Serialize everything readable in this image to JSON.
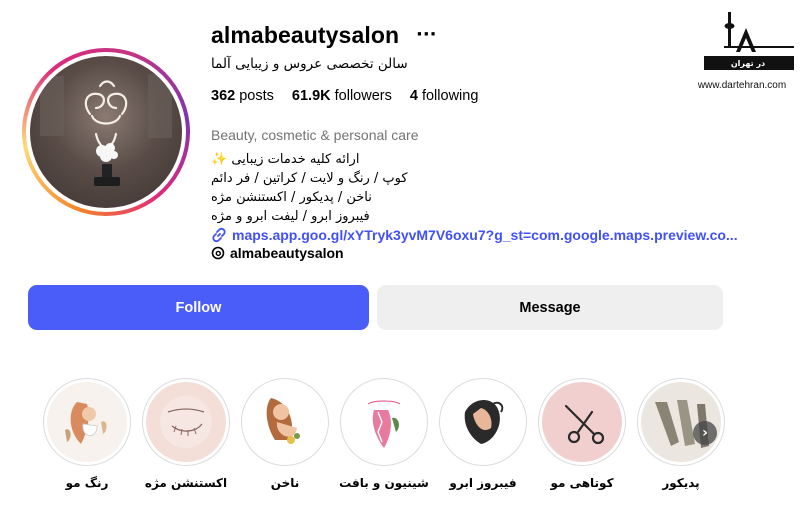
{
  "profile": {
    "username": "almabeautysalon",
    "more_icon": "more-horizontal-icon",
    "display_name": "سالن تخصصی عروس و زیبایی آلما",
    "stats": {
      "posts_count": "362",
      "posts_label": "posts",
      "followers_count": "61.9K",
      "followers_label": "followers",
      "following_count": "4",
      "following_label": "following"
    },
    "category": "Beauty, cosmetic & personal care",
    "bio_lines": [
      "ارائه کلیه خدمات زیبایی ✨",
      "کوپ / رنگ و لایت / کراتین / فر دائم",
      "ناخن / پدیکور / اکستنشن مژه",
      "فیبروز ابرو / لیفت ابرو و مژه"
    ],
    "link": "maps.app.goo.gl/xYTryk3yvM7V6oxu7?g_st=com.google.maps.preview.co...",
    "threads_handle": "almabeautysalon"
  },
  "actions": {
    "follow_label": "Follow",
    "message_label": "Message"
  },
  "highlights": [
    {
      "label": "رنگ مو"
    },
    {
      "label": "اکستنشن مژه"
    },
    {
      "label": "ناخن"
    },
    {
      "label": "شینیون و بافت"
    },
    {
      "label": "فیبروز ابرو"
    },
    {
      "label": "کوتاهی مو"
    },
    {
      "label": "پدیکور"
    }
  ],
  "watermark": {
    "title": "در تهران",
    "url": "www.dartehran.com"
  },
  "colors": {
    "follow_blue": "#4a5df9",
    "link_blue": "#4150f7",
    "message_gray": "#efefef"
  }
}
